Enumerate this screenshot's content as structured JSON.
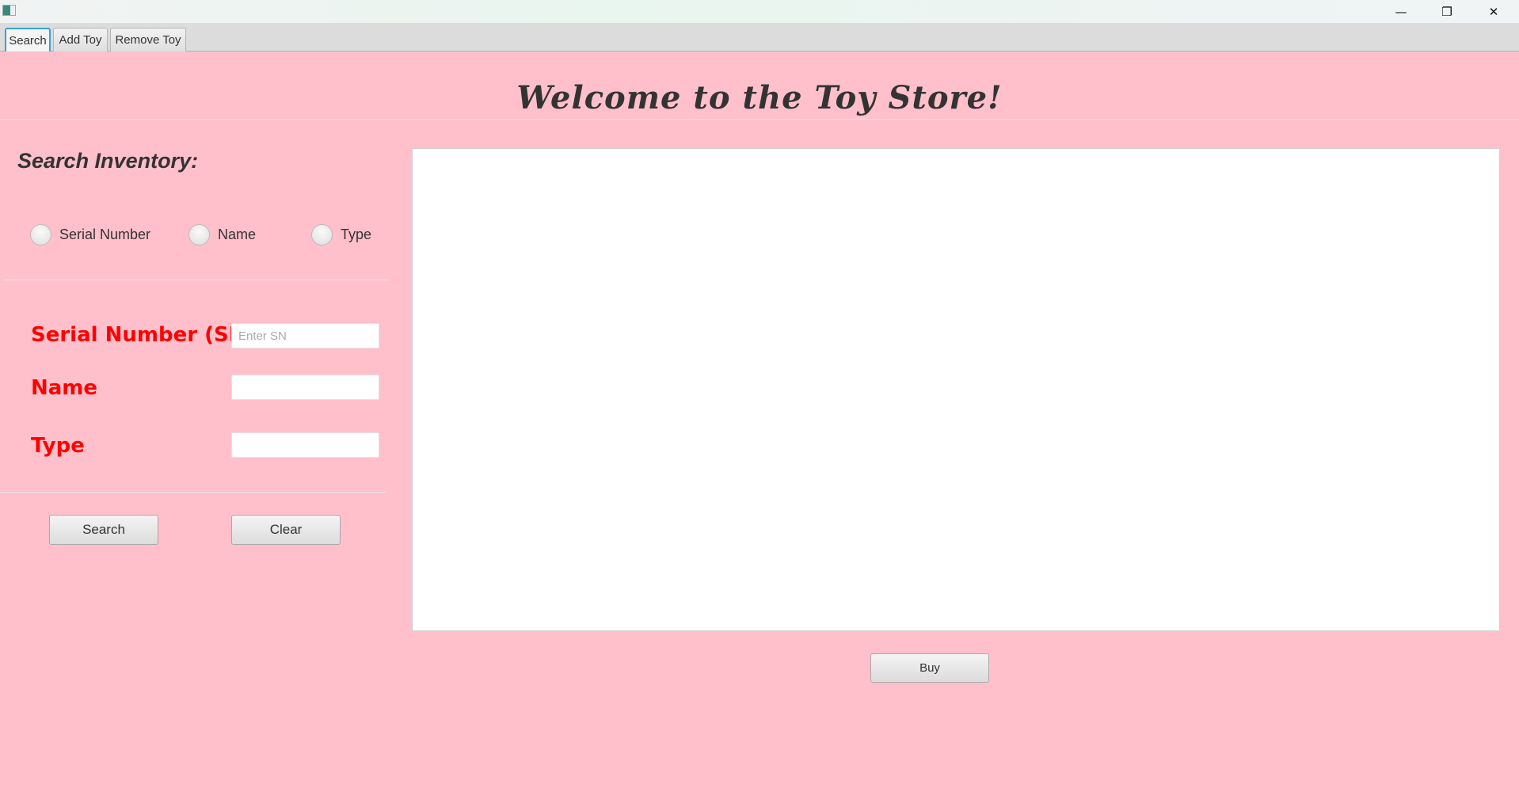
{
  "window": {
    "minimize": "—",
    "restore": "❐",
    "close": "✕"
  },
  "tabs": [
    {
      "label": "Search"
    },
    {
      "label": "Add Toy"
    },
    {
      "label": "Remove Toy"
    }
  ],
  "header": {
    "title": "Welcome to the Toy Store!"
  },
  "search": {
    "title": "Search Inventory:",
    "radios": [
      {
        "label": "Serial Number"
      },
      {
        "label": "Name"
      },
      {
        "label": "Type"
      }
    ],
    "fields": [
      {
        "label": "Serial Number (SN)",
        "placeholder": "Enter SN",
        "value": ""
      },
      {
        "label": "Name",
        "placeholder": "",
        "value": ""
      },
      {
        "label": "Type",
        "placeholder": "",
        "value": ""
      }
    ],
    "search_button": "Search",
    "clear_button": "Clear"
  },
  "results": {
    "buy_button": "Buy"
  }
}
